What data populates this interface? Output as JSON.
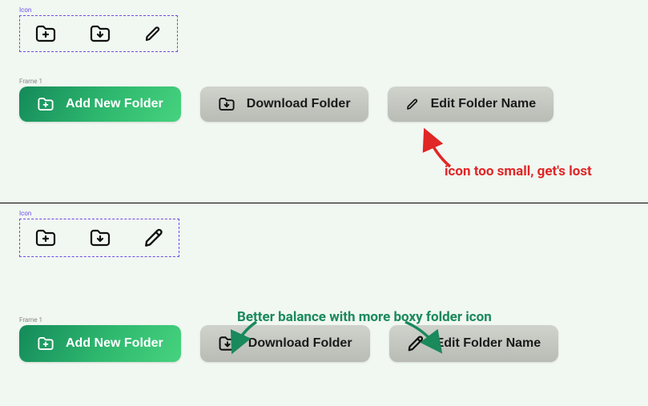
{
  "figma": {
    "icon_label": "Icon",
    "frame_label": "Frame 1"
  },
  "icons": {
    "add_folder": "folder-plus-icon",
    "download_folder": "folder-download-icon",
    "edit": "pencil-icon"
  },
  "buttons": {
    "add": "Add New Folder",
    "download": "Download Folder",
    "edit": "Edit Folder Name"
  },
  "annotations": {
    "red": "icon too small, get's lost",
    "green": "Better balance with more boxy folder icon"
  },
  "colors": {
    "accent_green_start": "#148a5a",
    "accent_green_end": "#46d37e",
    "anno_red": "#e02626",
    "anno_green": "#1a895b",
    "dashed_border": "#6b4eea"
  }
}
